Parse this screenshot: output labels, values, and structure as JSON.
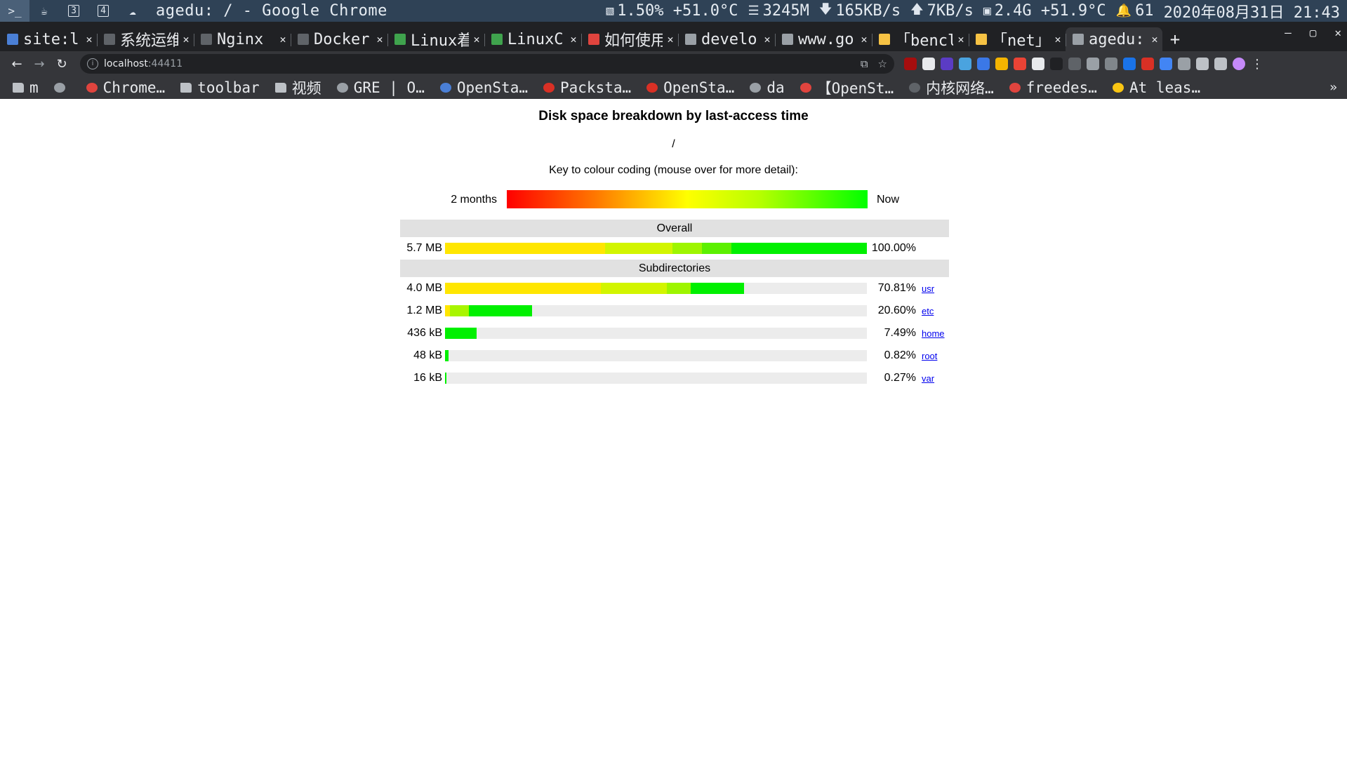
{
  "system_bar": {
    "window_title": "agedu: / - Google Chrome",
    "workspaces": [
      {
        "icon": "terminal-icon",
        "label": ""
      },
      {
        "icon": "coffee-icon",
        "label": ""
      },
      {
        "icon": "workspace-3-icon",
        "label": "3"
      },
      {
        "icon": "workspace-4-icon",
        "label": "4"
      },
      {
        "icon": "cloud-icon",
        "label": ""
      }
    ],
    "cpu": "1.50% +51.0°C",
    "memory": "3245M",
    "download": "165KB/s",
    "upload": "7KB/s",
    "disk": "2.4G +51.9°C",
    "notifications": "61",
    "datetime": "2020年08月31日 21:43"
  },
  "tabs": [
    {
      "title": "site:l",
      "favicon_color": "#4a7fd6"
    },
    {
      "title": "系统运维",
      "favicon_color": "#5f6368"
    },
    {
      "title": "Nginx",
      "favicon_color": "#5f6368"
    },
    {
      "title": "Docker",
      "favicon_color": "#5f6368"
    },
    {
      "title": "Linux着",
      "favicon_color": "#3fa34d"
    },
    {
      "title": "LinuxC",
      "favicon_color": "#3fa34d"
    },
    {
      "title": "如何使用",
      "favicon_color": "#e0443e"
    },
    {
      "title": "develo",
      "favicon_color": "#9aa0a6"
    },
    {
      "title": "www.go",
      "favicon_color": "#9aa0a6"
    },
    {
      "title": "「bencl",
      "favicon_color": "#f6c244"
    },
    {
      "title": "「net」",
      "favicon_color": "#f6c244"
    },
    {
      "title": "agedu:",
      "favicon_color": "#9aa0a6",
      "active": true
    }
  ],
  "toolbar": {
    "url_host": "localhost",
    "url_port": ":44411"
  },
  "bookmarks": [
    {
      "label": "m",
      "kind": "folder",
      "color": "#bdc1c6"
    },
    {
      "label": "",
      "kind": "site",
      "color": "#9aa0a6"
    },
    {
      "label": "Chrome…",
      "kind": "site",
      "color": "#e0443e"
    },
    {
      "label": "toolbar",
      "kind": "folder",
      "color": "#bdc1c6"
    },
    {
      "label": "视频",
      "kind": "folder",
      "color": "#bdc1c6"
    },
    {
      "label": "GRE | O…",
      "kind": "site",
      "color": "#9aa0a6"
    },
    {
      "label": "OpenSta…",
      "kind": "site",
      "color": "#4a7fd6"
    },
    {
      "label": "Packsta…",
      "kind": "site",
      "color": "#d93025"
    },
    {
      "label": "OpenSta…",
      "kind": "site",
      "color": "#d93025"
    },
    {
      "label": "da",
      "kind": "site",
      "color": "#9aa0a6"
    },
    {
      "label": "【OpenSt…",
      "kind": "site",
      "color": "#e0443e"
    },
    {
      "label": "内核网络…",
      "kind": "site",
      "color": "#5f6368"
    },
    {
      "label": "freedes…",
      "kind": "site",
      "color": "#e0443e"
    },
    {
      "label": "At leas…",
      "kind": "site",
      "color": "#f9c513"
    }
  ],
  "report": {
    "title": "Disk space breakdown by last-access time",
    "path": "/",
    "key_text": "Key to colour coding (mouse over for more detail):",
    "scale_left": "2 months",
    "scale_right": "Now",
    "overall_heading": "Overall",
    "subdir_heading": "Subdirectories",
    "overall": {
      "size": "5.7 MB",
      "percent": "100.00%",
      "fraction": 1.0,
      "segments": [
        {
          "color": "#ffe600",
          "share": 0.38
        },
        {
          "color": "#d2f500",
          "share": 0.16
        },
        {
          "color": "#9ef500",
          "share": 0.07
        },
        {
          "color": "#5cf000",
          "share": 0.07
        },
        {
          "color": "#00f000",
          "share": 0.32
        }
      ]
    },
    "subdirectories": [
      {
        "size": "4.0 MB",
        "percent": "70.81%",
        "name": "usr",
        "fraction": 0.7081,
        "segments": [
          {
            "color": "#ffe600",
            "share": 0.52
          },
          {
            "color": "#d2f500",
            "share": 0.22
          },
          {
            "color": "#9ef500",
            "share": 0.08
          },
          {
            "color": "#00f000",
            "share": 0.18
          }
        ]
      },
      {
        "size": "1.2 MB",
        "percent": "20.60%",
        "name": "etc",
        "fraction": 0.206,
        "segments": [
          {
            "color": "#ffe600",
            "share": 0.06
          },
          {
            "color": "#a8f500",
            "share": 0.22
          },
          {
            "color": "#00f000",
            "share": 0.72
          }
        ]
      },
      {
        "size": "436 kB",
        "percent": "7.49%",
        "name": "home",
        "fraction": 0.0749,
        "segments": [
          {
            "color": "#00f000",
            "share": 1.0
          }
        ]
      },
      {
        "size": "48 kB",
        "percent": "0.82%",
        "name": "root",
        "fraction": 0.0082,
        "segments": [
          {
            "color": "#00f000",
            "share": 1.0
          }
        ]
      },
      {
        "size": "16 kB",
        "percent": "0.27%",
        "name": "var",
        "fraction": 0.0027,
        "segments": [
          {
            "color": "#00f000",
            "share": 1.0
          }
        ]
      }
    ]
  }
}
